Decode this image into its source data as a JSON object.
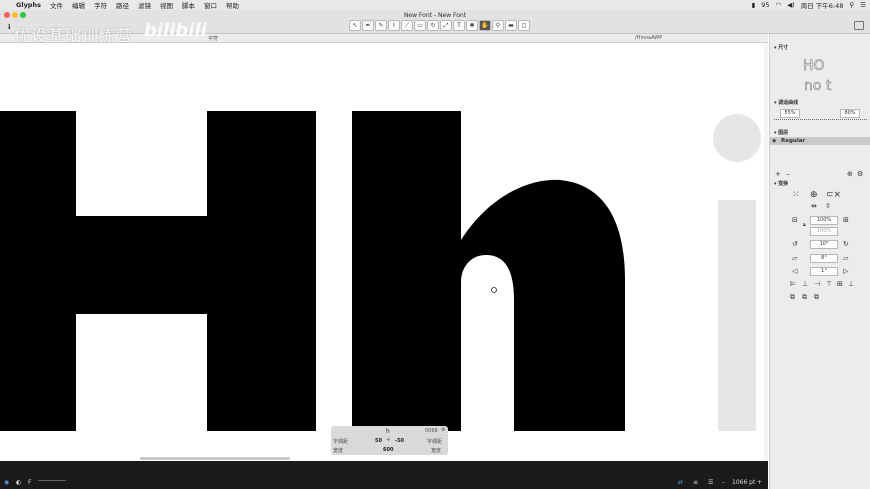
{
  "menubar": {
    "app": "Glyphs",
    "items": [
      "文件",
      "编辑",
      "字符",
      "路径",
      "滤镜",
      "视图",
      "脚本",
      "窗口",
      "帮助"
    ],
    "battery": "95",
    "clock": "周日 下午6:48"
  },
  "window": {
    "title": "New Font - New Font"
  },
  "tabs": {
    "left": "字符",
    "right": "/HinoaAWP"
  },
  "watermark": {
    "text": "优设基础训练营",
    "logo": "bilibili"
  },
  "info": {
    "glyph": "h",
    "unicode": "0068",
    "lsb_label": "字偶距",
    "lsb": "50",
    "rsb": "-50",
    "rsb_label": "字偶距",
    "width_label": "宽度",
    "width": "600",
    "width_label2": "宽度"
  },
  "bottom": {
    "zoom": "1066 pt"
  },
  "sidebar": {
    "dimensions_label": "尺寸",
    "preview1": "HO",
    "preview2": "no t",
    "curvature_label": "调适曲线",
    "curve_a": "55%",
    "curve_b": "80%",
    "layers_label": "图层",
    "layer_name": "Regular",
    "transform_label": "变换",
    "scale_a": "100%",
    "scale_b": "100%",
    "rotate": "10°",
    "slant": "8°",
    "skew": "1°"
  },
  "colors": {
    "glyph": "#000000",
    "ghost_glyph": "#e6e6e6",
    "bottombar": "#1b1b1b",
    "selection": "#4a90e2"
  }
}
